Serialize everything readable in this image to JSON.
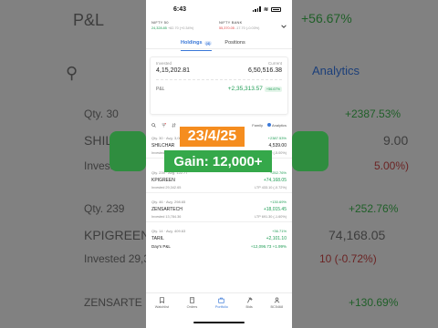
{
  "status_bar": {
    "time": "6:43"
  },
  "indices": [
    {
      "name": "NIFTY 50",
      "value": "24,328.85",
      "change": "+82.70 (+0.34%)",
      "direction": "up"
    },
    {
      "name": "NIFTY BANK",
      "value": "55,370.05",
      "change": "-17.70 (-0.03%)",
      "direction": "down"
    }
  ],
  "tabs": {
    "holdings_label": "Holdings",
    "holdings_count": "(4)",
    "positions_label": "Positions"
  },
  "summary": {
    "invested_label": "Invested",
    "invested_value": "4,15,202.81",
    "current_label": "Current",
    "current_value": "6,50,516.38",
    "pnl_label": "P&L",
    "pnl_value": "+2,35,313.57",
    "pnl_pct": "+56.67%"
  },
  "toolbar": {
    "family_label": "Family",
    "analytics_label": "Analytics"
  },
  "holdings": [
    {
      "qty": "Qty. 30",
      "avg": "Avg. 3,065.70",
      "pct": "+2387.53%",
      "name": "SHILCHAR",
      "ltp": "4,539.00",
      "invested": "Invested 91,971.00",
      "ltp_label": "LTP 4,539.00 (-5.00%)"
    },
    {
      "qty": "Qty. 239",
      "avg": "Avg. 122.77",
      "pct": "+252.76%",
      "name": "KPIGREEN",
      "ltp": "+74,168.05",
      "invested": "Invested 29,342.65",
      "ltp_label": "LTP 433.10 (-0.72%)"
    },
    {
      "qty": "Qty. 46",
      "avg": "Avg. 298.65",
      "pct": "+130.69%",
      "name": "ZENSARTECH",
      "ltp": "+18,015.45",
      "invested": "Invested 13,784.36",
      "ltp_label": "LTP 691.30 (-1.60%)"
    },
    {
      "qty": "Qty. 14",
      "avg": "Avg. 409.63",
      "pct": "+36.71%",
      "name": "TARIL",
      "ltp": "+2,101.10",
      "invested": "",
      "ltp_label": ""
    }
  ],
  "days_pnl": {
    "label": "Day's P&L",
    "value": "+12,096.73",
    "pct": "+1.99%"
  },
  "overlay": {
    "date": "23/4/25",
    "gain": "Gain: 12,000+"
  },
  "nav": [
    {
      "label": "Watchlist",
      "icon": "bookmark-icon"
    },
    {
      "label": "Orders",
      "icon": "book-icon"
    },
    {
      "label": "Portfolio",
      "icon": "briefcase-icon",
      "active": true
    },
    {
      "label": "Bids",
      "icon": "gavel-icon"
    },
    {
      "label": "BC5468",
      "icon": "user-icon"
    }
  ],
  "background": {
    "pl_title": "P&L",
    "pct_main": "+56.67%",
    "analytics": "Analytics",
    "rows": [
      {
        "left": "Qty. 30",
        "right": "+2387.53%"
      },
      {
        "left": "SHILCH",
        "right": "9.00"
      },
      {
        "left": "Invested",
        "right": "5.00%)"
      },
      {
        "left": "Qty. 239",
        "right": "+252.76%"
      },
      {
        "left": "KPIGREEN",
        "right": "74,168.05"
      },
      {
        "left": "Invested 29,3",
        "right": "10 (-0.72%)"
      },
      {
        "left": "ZENSARTE",
        "right": "+130.69%"
      }
    ]
  },
  "colors": {
    "green": "#1f9d55",
    "red": "#e04343",
    "accent": "#3a78d8",
    "orange": "#f58d1f",
    "badge_green": "#35a84a"
  }
}
